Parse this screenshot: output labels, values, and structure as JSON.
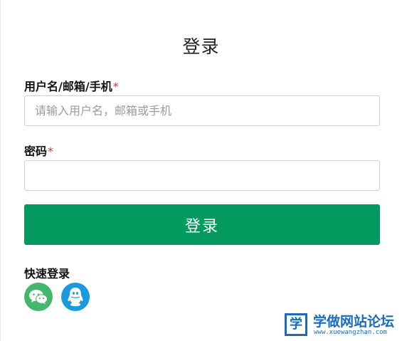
{
  "page": {
    "title": "登录"
  },
  "form": {
    "username_label": "用户名/邮箱/手机",
    "username_placeholder": "请输入用户名，邮箱或手机",
    "username_value": "",
    "password_label": "密码",
    "password_value": "",
    "required_mark": "*",
    "submit_label": "登录"
  },
  "quick_login": {
    "label": "快速登录",
    "options": [
      {
        "name": "WeChat",
        "icon": "wechat-icon",
        "color": "#45b76a"
      },
      {
        "name": "QQ",
        "icon": "qq-icon",
        "color": "#1a9ae0"
      }
    ]
  },
  "watermark": {
    "logo_char": "学",
    "title": "学做网站论坛",
    "url": "www.xuewangzhan.com"
  },
  "colors": {
    "accent": "#049a5f",
    "required": "#d9353a",
    "watermark": "#1c6bb8"
  }
}
